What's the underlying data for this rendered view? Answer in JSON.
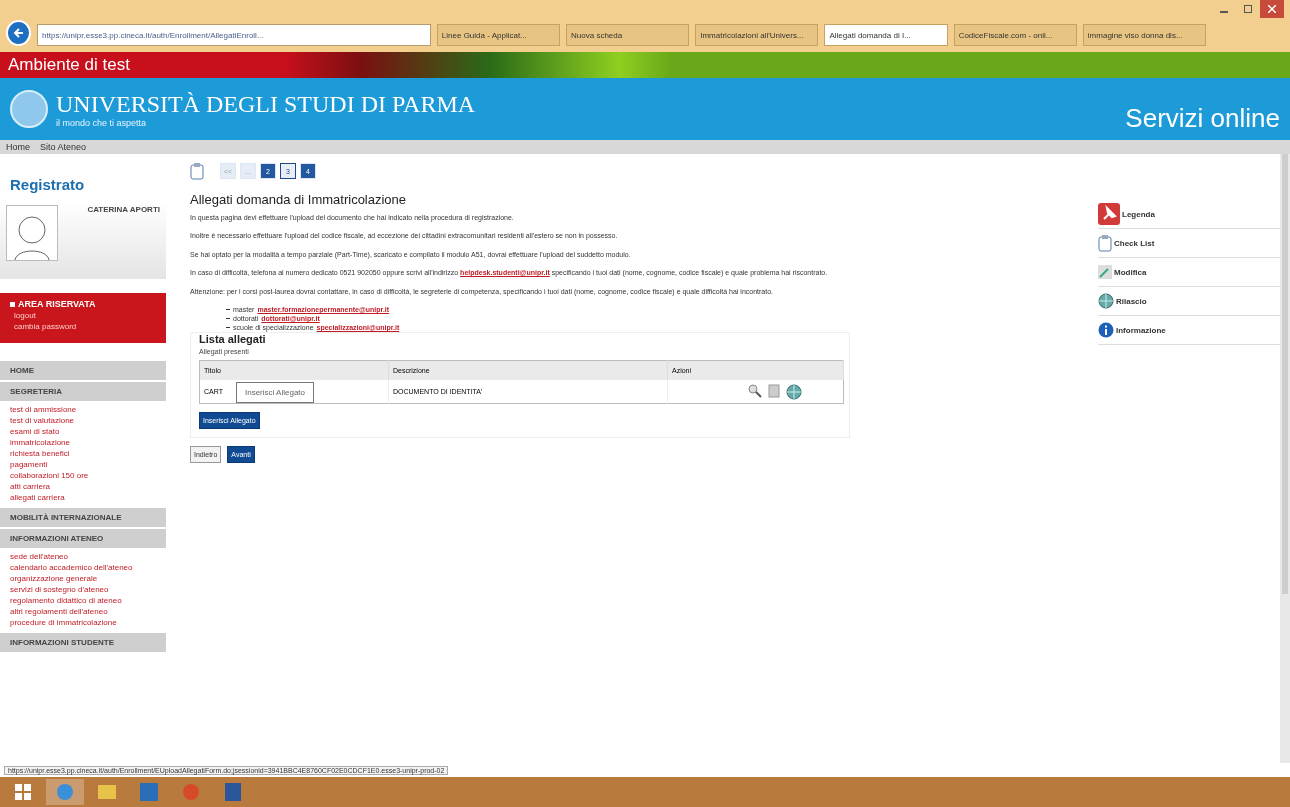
{
  "browser": {
    "url": "https://unipr.esse3.pp.cineca.it/auth/Enrollment/AllegatiEnroll...",
    "tabs": [
      {
        "title": "Linee Guida - Applicat...",
        "selected": false
      },
      {
        "title": "Nuova scheda",
        "selected": false
      },
      {
        "title": "Immatricolazioni all'Univers...",
        "selected": false
      },
      {
        "title": "Allegati domanda di I...",
        "selected": true
      },
      {
        "title": "CodiceFiscale.com - onli...",
        "selected": false
      },
      {
        "title": "immagine viso donna dis...",
        "selected": false
      }
    ],
    "status_url": "https://unipr.esse3.pp.cineca.it/auth/Enrollment/EUploadAllegatiForm.do;jsessionid=3941BBC4E8760CF02E0CDCF1E0.esse3-unipr-prod-02"
  },
  "env_banner": "Ambiente di test",
  "header": {
    "title": "UNIVERSITÀ DEGLI STUDI DI PARMA",
    "tagline": "il mondo che ti aspetta",
    "brand": "Servizi online"
  },
  "nav": [
    "Home",
    "Sito Ateneo"
  ],
  "sidebar": {
    "title": "Registrato",
    "user": "CATERINA APORTI",
    "reserved": {
      "title": "AREA RISERVATA",
      "links": [
        "logout",
        "cambia password"
      ]
    },
    "sections": [
      {
        "title": "HOME"
      },
      {
        "title": "SEGRETERIA",
        "items": [
          "test di ammissione",
          "test di valutazione",
          "esami di stato",
          "immatricolazione",
          "richiesta benefici",
          "pagamenti",
          "collaborazioni 150 ore",
          "atti carriera",
          "allegati carriera"
        ]
      },
      {
        "title": "MOBILITÀ INTERNAZIONALE"
      },
      {
        "title": "INFORMAZIONI ATENEO",
        "items": [
          "sede dell'ateneo",
          "calendario accademico dell'ateneo",
          "organizzazione generale",
          "servizi di sostegno d'ateneo",
          "regolamento didattico di ateneo",
          "altri regolamenti dell'ateneo",
          "procedure di immatricolazione"
        ]
      },
      {
        "title": "INFORMAZIONI STUDENTE"
      }
    ]
  },
  "steps": [
    {
      "label": "<<",
      "selected": false
    },
    {
      "label": "...",
      "selected": false
    },
    {
      "label": "2",
      "selected": false
    },
    {
      "label": "3",
      "selected": true
    },
    {
      "label": "4",
      "selected": false
    }
  ],
  "page": {
    "title": "Allegati domanda di Immatricolazione",
    "paragraphs": [
      [
        {
          "kind": "text",
          "text": "In questa pagina devi effettuare l'upload del documento che hai indicato nella procedura di registrazione."
        }
      ],
      [
        {
          "kind": "text",
          "text": "Inoltre è necessario effettuare l'upload del codice fiscale, ad eccezione dei cittadini extracomunitari residenti all'estero se non in possesso."
        }
      ],
      [
        {
          "kind": "text",
          "text": "Se hai optato per la modalità a tempo parziale (Part-Time), scaricato e compilato il modulo A51, dovrai effettuare l'upload del suddetto modulo."
        }
      ],
      [
        {
          "kind": "text",
          "text": "In caso di difficoltà, telefona al numero dedicato 0521 902050 oppure scrivi all'indirizzo "
        },
        {
          "kind": "link",
          "text": "helpdesk.studenti@unipr.it"
        },
        {
          "kind": "text",
          "text": " specificando i tuoi dati (nome, cognome, codice fiscale) e quale problema hai riscontrato."
        }
      ],
      [
        {
          "kind": "text",
          "text": "Attenzione: per i corsi post-laurea dovrai contattare, in caso di difficoltà, le segreterie di competenza, specificando i tuoi dati (nome, cognome, codice fiscale) e quale difficoltà hai incontrato."
        }
      ]
    ],
    "contacts": [
      {
        "label": "master",
        "email": "master.formazionepermanente@unipr.it"
      },
      {
        "label": "dottorati",
        "email": "dottorati@unipr.it"
      },
      {
        "label": "scuole di specializzazione",
        "email": "specializzazioni@unipr.it"
      }
    ]
  },
  "attachments": {
    "title": "Lista allegati",
    "subtitle": "Allegati presenti",
    "columns": [
      "Titolo",
      "Descrizione",
      "Azioni"
    ],
    "rows": [
      {
        "title": "CART",
        "description": "DOCUMENTO DI IDENTITA'"
      }
    ],
    "tooltip": "Inserisci Allegato",
    "add_button": "Inserisci Allegato"
  },
  "buttons": [
    {
      "label": "Indietro",
      "kind": "secondary"
    },
    {
      "label": "Avanti",
      "kind": "primary"
    }
  ],
  "right_panel": [
    {
      "label": "Legenda"
    },
    {
      "label": "Check List"
    },
    {
      "label": "Modifica"
    },
    {
      "label": "Rilascio"
    },
    {
      "label": "Informazione"
    }
  ]
}
